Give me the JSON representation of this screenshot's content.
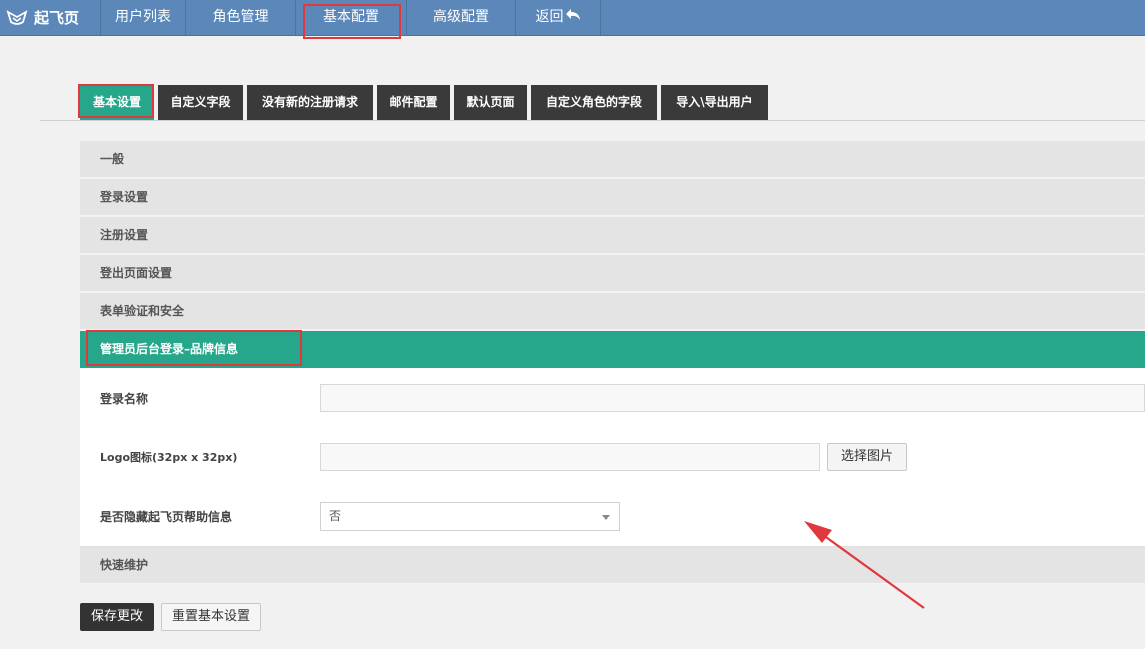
{
  "app": {
    "brand": "起飞页"
  },
  "nav": [
    {
      "label": "用户列表"
    },
    {
      "label": "角色管理"
    },
    {
      "label": "基本配置"
    },
    {
      "label": "高级配置"
    },
    {
      "label": "返回"
    }
  ],
  "tabs": [
    {
      "label": "基本设置"
    },
    {
      "label": "自定义字段"
    },
    {
      "label": "没有新的注册请求"
    },
    {
      "label": "邮件配置"
    },
    {
      "label": "默认页面"
    },
    {
      "label": "自定义角色的字段"
    },
    {
      "label": "导入\\导出用户"
    }
  ],
  "sections": [
    {
      "label": "一般"
    },
    {
      "label": "登录设置"
    },
    {
      "label": "注册设置"
    },
    {
      "label": "登出页面设置"
    },
    {
      "label": "表单验证和安全"
    },
    {
      "label": "管理员后台登录–品牌信息"
    },
    {
      "label": "快速维护"
    }
  ],
  "form": {
    "login_name_label": "登录名称",
    "login_name_value": "",
    "logo_label": "Logo图标(32px x 32px)",
    "logo_value": "",
    "choose_image_label": "选择图片",
    "hide_help_label": "是否隐藏起飞页帮助信息",
    "hide_help_value": "否"
  },
  "actions": {
    "save_label": "保存更改",
    "reset_label": "重置基本设置"
  },
  "colors": {
    "topbar": "#5b87b9",
    "active_tab": "#26a68b",
    "annotation": "#e0383c"
  }
}
